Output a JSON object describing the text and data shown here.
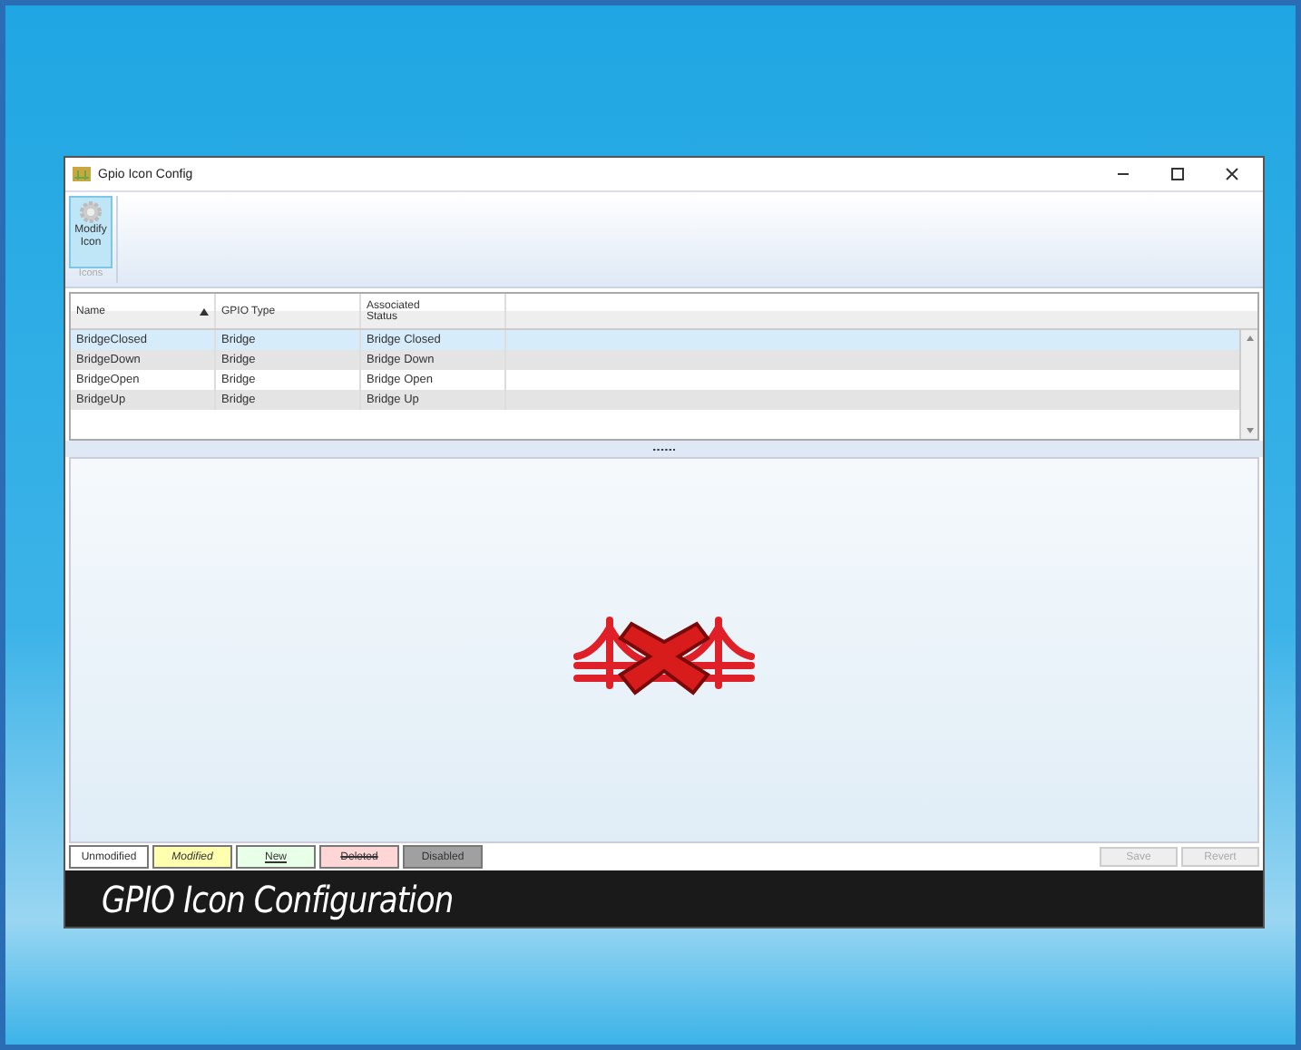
{
  "window": {
    "title": "Gpio Icon Config"
  },
  "ribbon": {
    "buttons": [
      {
        "label": "Modify Icon",
        "selected": true
      }
    ],
    "group": "Icons"
  },
  "table": {
    "columns": [
      {
        "label": "Name",
        "sorted": true
      },
      {
        "label": "GPIO Type",
        "sorted": false
      },
      {
        "label": "Associated Status",
        "sorted": false
      }
    ],
    "rows": [
      {
        "cells": [
          "BridgeClosed",
          "Bridge",
          "Bridge Closed"
        ],
        "selected": true
      },
      {
        "cells": [
          "BridgeDown",
          "Bridge",
          "Bridge Down"
        ],
        "selected": false
      },
      {
        "cells": [
          "BridgeOpen",
          "Bridge",
          "Bridge Open"
        ],
        "selected": false
      },
      {
        "cells": [
          "BridgeUp",
          "Bridge",
          "Bridge Up"
        ],
        "selected": false
      }
    ]
  },
  "legend": [
    {
      "label": "Unmodified",
      "kind": "unmodified"
    },
    {
      "label": "Modified",
      "kind": "modified"
    },
    {
      "label": "New",
      "kind": "new"
    },
    {
      "label": "Deleted",
      "kind": "deleted"
    },
    {
      "label": "Disabled",
      "kind": "disabled"
    }
  ],
  "actions": [
    {
      "label": "Save",
      "disabled": true
    },
    {
      "label": "Revert",
      "disabled": true
    }
  ],
  "caption": "GPIO Icon Configuration"
}
